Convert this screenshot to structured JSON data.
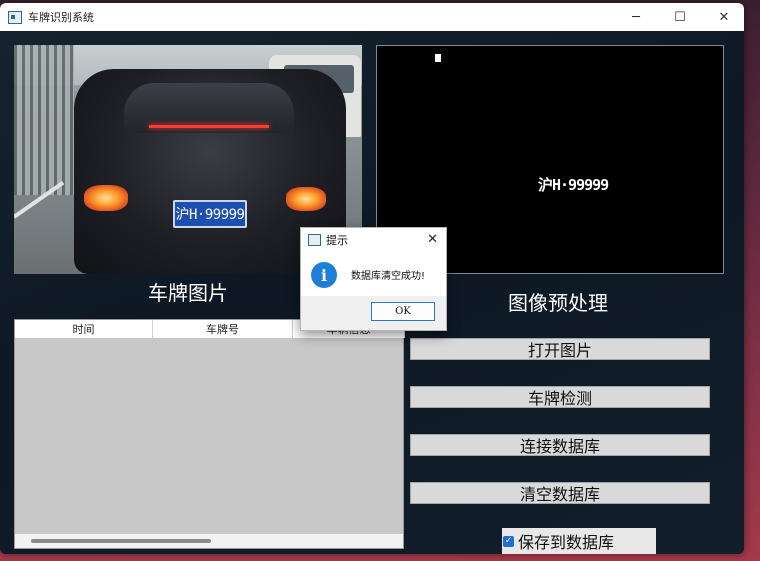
{
  "window": {
    "title": "车牌识别系统",
    "controls": {
      "minimize": "─",
      "maximize": "☐",
      "close": "✕"
    }
  },
  "left_panel": {
    "plate_text": "沪H·99999",
    "caption": "车牌图片"
  },
  "right_panel": {
    "plate_text": "沪H·99999",
    "caption": "图像预处理"
  },
  "table": {
    "columns": [
      "时间",
      "车牌号",
      "车辆信息"
    ]
  },
  "buttons": {
    "open_image": "打开图片",
    "detect_plate": "车牌检测",
    "connect_db": "连接数据库",
    "clear_db": "清空数据库"
  },
  "save_checkbox": {
    "label": "保存到数据库",
    "checked": true
  },
  "dialog": {
    "title": "提示",
    "message": "数据库清空成功!",
    "ok_label": "OK",
    "close_glyph": "✕",
    "info_glyph": "i"
  },
  "colors": {
    "accent": "#1e7fd6",
    "plate_blue": "#1c4fb0",
    "window_bg": "#0f1b28"
  }
}
